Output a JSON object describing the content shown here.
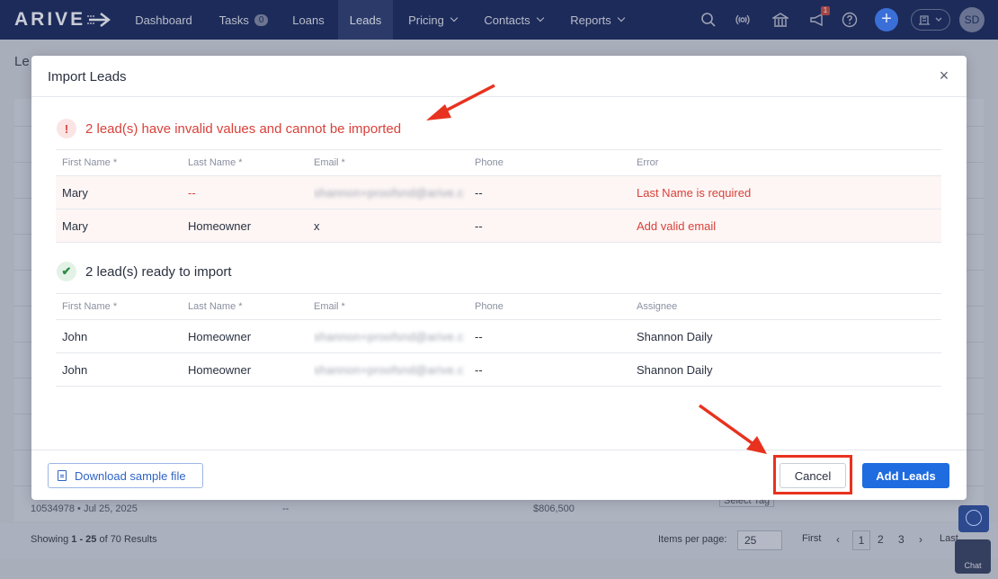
{
  "app": {
    "logo_text": "ARIVE",
    "nav": [
      {
        "label": "Dashboard"
      },
      {
        "label": "Tasks",
        "badge": "0"
      },
      {
        "label": "Loans"
      },
      {
        "label": "Leads",
        "active": true
      },
      {
        "label": "Pricing",
        "dropdown": true
      },
      {
        "label": "Contacts",
        "dropdown": true
      },
      {
        "label": "Reports",
        "dropdown": true
      }
    ],
    "notification_count": "1",
    "avatar_initials": "SD"
  },
  "background": {
    "page_title": "Le",
    "row_loan_id": "10534978",
    "row_date": "Jul 25, 2025",
    "row_dash": "--",
    "row_amount": "$806,500",
    "row_tag": "Select Tag",
    "showing_prefix": "Showing ",
    "showing_range": "1 - 25",
    "showing_suffix": " of 70 Results",
    "items_per_page_label": "Items per page:",
    "items_per_page_value": "25",
    "pagination": {
      "first": "First",
      "current": "1",
      "page2": "2",
      "page3": "3",
      "last": "Last"
    },
    "chat_label": "Chat"
  },
  "modal": {
    "title": "Import Leads",
    "close_glyph": "×",
    "invalid_section": {
      "icon_glyph": "!",
      "heading": "2 lead(s) have invalid values and cannot be imported",
      "columns": [
        "First Name *",
        "Last Name *",
        "Email *",
        "Phone",
        "Error"
      ],
      "rows": [
        {
          "first": "Mary",
          "last": "--",
          "email": "shannon+proofsnd@arive.c",
          "phone": "--",
          "error": "Last Name is required"
        },
        {
          "first": "Mary",
          "last": "Homeowner",
          "email": "x",
          "phone": "--",
          "error": "Add valid email"
        }
      ]
    },
    "valid_section": {
      "icon_glyph": "✔",
      "heading": "2 lead(s) ready to import",
      "columns": [
        "First Name *",
        "Last Name *",
        "Email *",
        "Phone",
        "Assignee"
      ],
      "rows": [
        {
          "first": "John",
          "last": "Homeowner",
          "email": "shannon+proofsnd@arive.c",
          "phone": "--",
          "assignee": "Shannon Daily"
        },
        {
          "first": "John",
          "last": "Homeowner",
          "email": "shannon+proofsnd@arive.c",
          "phone": "--",
          "assignee": "Shannon Daily"
        }
      ]
    },
    "footer": {
      "download_label": "Download sample file",
      "cancel_label": "Cancel",
      "add_label": "Add Leads"
    }
  },
  "colors": {
    "nav_bg": "#1d2b5a",
    "primary": "#1f6be0",
    "error": "#d9413a",
    "success": "#2f8a45",
    "annotation": "#e8321f"
  }
}
